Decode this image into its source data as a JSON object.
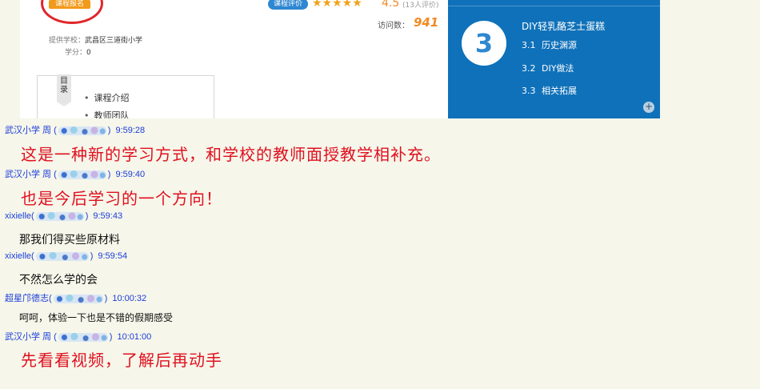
{
  "course": {
    "enroll_label": "课程报名",
    "rating_label": "课程评价",
    "stars": "★★★★★",
    "rating_score": "4.5",
    "rating_count": "(13人评价)",
    "visits_label": "访问数：",
    "visits_count": "941",
    "school_label": "提供学校：",
    "school_value": "武昌区三道街小学",
    "credits_label": "学分：",
    "credits_value": "0",
    "toc_tab": "目录",
    "toc_items": [
      "课程介绍",
      "教师团队"
    ],
    "section_number": "3",
    "section_title": "DIY轻乳酪芝士蛋糕",
    "subsections": [
      {
        "num": "3.1",
        "label": "历史渊源"
      },
      {
        "num": "3.2",
        "label": "DIY做法"
      },
      {
        "num": "3.3",
        "label": "相关拓展"
      }
    ],
    "expand_icon": "plus-icon",
    "colors": {
      "panel_blue": "#0f71b9",
      "accent_orange": "#f08a24",
      "enroll_red": "#e0272b"
    }
  },
  "chat": {
    "messages": [
      {
        "sender": "武汉小学 周 (",
        "close": ")",
        "time": "9:59:28",
        "text": "这是一种新的学习方式，和学校的教师面授教学相补充。",
        "style": "red"
      },
      {
        "sender": "武汉小学 周 (",
        "close": ")",
        "time": "9:59:40",
        "text": "也是今后学习的一个方向！",
        "style": "red"
      },
      {
        "sender": "xixielle(",
        "close": ")",
        "time": "9:59:43",
        "text": "那我们得买些原材料",
        "style": "black"
      },
      {
        "sender": "xixielle(",
        "close": ")",
        "time": "9:59:54",
        "text": "不然怎么学的会",
        "style": "black"
      },
      {
        "sender": "超星邝德志(",
        "close": ")",
        "time": "10:00:32",
        "text": "呵呵，体验一下也是不错的假期感受",
        "style": "small"
      },
      {
        "sender": "武汉小学 周 (",
        "close": ")",
        "time": "10:01:00",
        "text": "先看看视频，了解后再动手",
        "style": "red"
      }
    ],
    "colors": {
      "sender": "#1a3ddb",
      "red_text": "#e0101f",
      "background": "#f6f6ea"
    }
  }
}
